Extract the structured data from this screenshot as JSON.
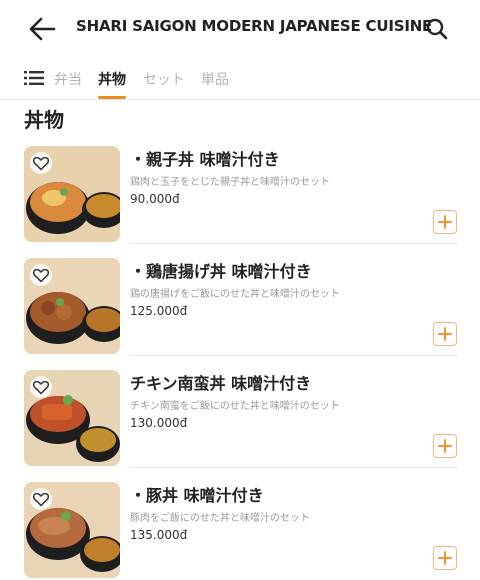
{
  "header": {
    "title": "SHARI SAIGON MODERN JAPANESE CUISINE",
    "back_icon": "arrow-left-icon",
    "search_icon": "search-icon"
  },
  "tabs": [
    {
      "label": "弁当",
      "active": false
    },
    {
      "label": "丼物",
      "active": true
    },
    {
      "label": "セット",
      "active": false
    },
    {
      "label": "単品",
      "active": false
    }
  ],
  "section": {
    "title": "丼物"
  },
  "items": [
    {
      "name": "・親子丼 味噌汁付き",
      "desc": "鶏肉と玉子をとじた親子丼と味噌汁のセット",
      "price": "90.000đ"
    },
    {
      "name": "・鶏唐揚げ丼 味噌汁付き",
      "desc": "鶏の唐揚げをご飯にのせた丼と味噌汁のセット",
      "price": "125.000đ"
    },
    {
      "name": "チキン南蛮丼 味噌汁付き",
      "desc": "チキン南蛮をご飯にのせた丼と味噌汁のセット",
      "price": "130.000đ"
    },
    {
      "name": "・豚丼 味噌汁付き",
      "desc": "豚肉をご飯にのせた丼と味噌汁のセット",
      "price": "135.000đ"
    }
  ],
  "colors": {
    "accent": "#f08a1c",
    "add_border": "#f0b57a"
  }
}
